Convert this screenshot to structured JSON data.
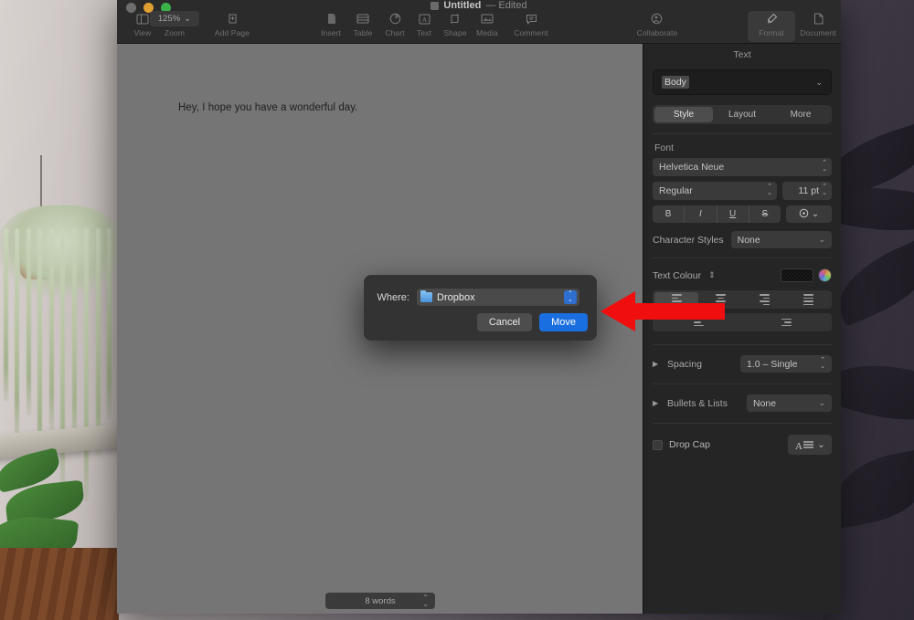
{
  "window": {
    "title": "Untitled",
    "edited": "— Edited",
    "traffic": {
      "close": "close-button",
      "minimize": "minimize-button",
      "zoom": "zoom-button"
    }
  },
  "toolbar": {
    "items": [
      {
        "label": "View",
        "icon": "sidebar-icon"
      },
      {
        "label": "Zoom",
        "icon": "zoom-icon",
        "value": "125%"
      },
      {
        "label": "Add Page",
        "icon": "add-page-icon"
      },
      {
        "label": "Insert",
        "icon": "insert-icon"
      },
      {
        "label": "Table",
        "icon": "table-icon"
      },
      {
        "label": "Chart",
        "icon": "chart-icon"
      },
      {
        "label": "Text",
        "icon": "text-icon"
      },
      {
        "label": "Shape",
        "icon": "shape-icon"
      },
      {
        "label": "Media",
        "icon": "media-icon"
      },
      {
        "label": "Comment",
        "icon": "comment-icon"
      },
      {
        "label": "Collaborate",
        "icon": "collaborate-icon"
      },
      {
        "label": "Format",
        "icon": "format-brush-icon"
      },
      {
        "label": "Document",
        "icon": "document-icon"
      }
    ]
  },
  "document": {
    "body_text": "Hey, I hope you have a wonderful day.",
    "word_count": "8 words"
  },
  "inspector": {
    "title": "Text",
    "paragraph_style": "Body",
    "tabs": [
      {
        "label": "Style",
        "active": true
      },
      {
        "label": "Layout",
        "active": false
      },
      {
        "label": "More",
        "active": false
      }
    ],
    "font": {
      "section_label": "Font",
      "family": "Helvetica Neue",
      "weight": "Regular",
      "size": "11 pt",
      "bold": "B",
      "italic": "I",
      "underline": "U",
      "strikethrough": "S"
    },
    "character_styles": {
      "label": "Character Styles",
      "value": "None"
    },
    "text_colour": {
      "label": "Text Colour",
      "swatch": "#141414"
    },
    "alignment": {
      "options": [
        "align-left",
        "align-center",
        "align-right",
        "align-justify"
      ],
      "active": "align-left",
      "indent_options": [
        "decrease-indent",
        "increase-indent"
      ]
    },
    "spacing": {
      "label": "Spacing",
      "value": "1.0 – Single"
    },
    "bullets": {
      "label": "Bullets & Lists",
      "value": "None"
    },
    "drop_cap": {
      "label": "Drop Cap",
      "checked": false
    }
  },
  "sheet": {
    "where_label": "Where:",
    "where_value": "Dropbox",
    "cancel_label": "Cancel",
    "move_label": "Move"
  },
  "annotation": {
    "arrow_color": "#f00e0e",
    "direction": "left"
  }
}
